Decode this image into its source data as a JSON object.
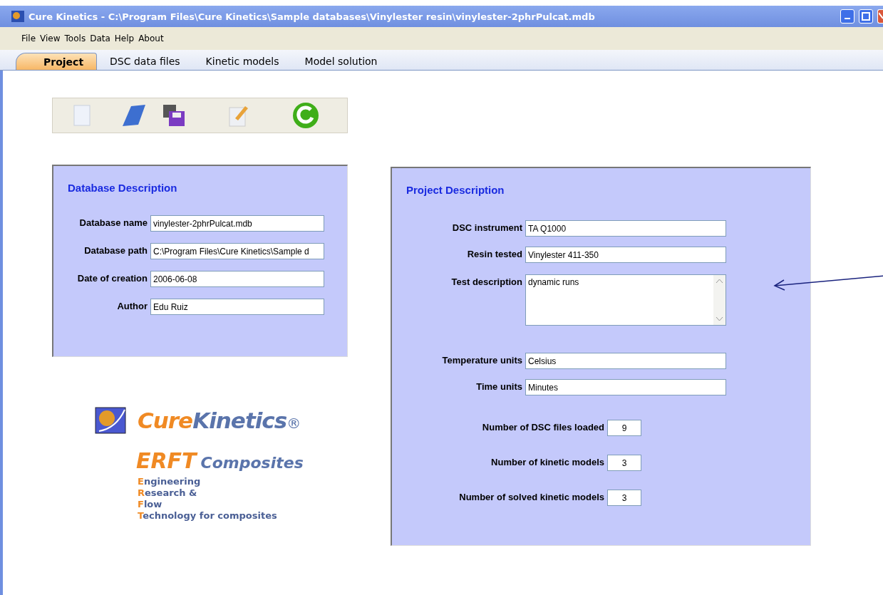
{
  "window": {
    "title": "Cure Kinetics - C:\\Program Files\\Cure Kinetics\\Sample databases\\Vinylester resin\\vinylester-2phrPulcat.mdb"
  },
  "menu": [
    "File",
    "View",
    "Tools",
    "Data",
    "Help",
    "About"
  ],
  "tabs": [
    {
      "label": "Project",
      "selected": true
    },
    {
      "label": "DSC data files",
      "selected": false
    },
    {
      "label": "Kinetic models",
      "selected": false
    },
    {
      "label": "Model solution",
      "selected": false
    }
  ],
  "database": {
    "title": "Database Description",
    "fields": [
      {
        "label": "Database name",
        "value": "vinylester-2phrPulcat.mdb"
      },
      {
        "label": "Database path",
        "value": "C:\\Program Files\\Cure Kinetics\\Sample d"
      },
      {
        "label": "Date of creation",
        "value": "2006-06-08"
      },
      {
        "label": "Author",
        "value": "Edu Ruiz"
      }
    ]
  },
  "logo": {
    "parts": [
      {
        "text": "Cure",
        "color": "#f08a24"
      },
      {
        "text": "Kinetics",
        "color": "#5a74ab"
      }
    ],
    "mark": "®"
  },
  "erft": {
    "parts": [
      {
        "text": "ERFT",
        "color": "#f08a24"
      },
      {
        "text": "Composites",
        "color": "#5a74ab"
      }
    ],
    "tagline": [
      {
        "initial": "E",
        "rest": "ngineering"
      },
      {
        "initial": "R",
        "rest": "esearch &"
      },
      {
        "initial": "F",
        "rest": "low"
      },
      {
        "initial": "T",
        "rest": "echnology for composites"
      }
    ]
  },
  "project": {
    "title": "Project Description",
    "fields": [
      {
        "kind": "text",
        "label": "DSC instrument",
        "value": "TA Q1000"
      },
      {
        "kind": "text",
        "label": "Resin tested",
        "value": "Vinylester 411-350"
      },
      {
        "kind": "memo",
        "label": "Test description",
        "value": "dynamic runs"
      },
      {
        "kind": "text",
        "label": "Temperature units",
        "value": "Celsius"
      },
      {
        "kind": "text",
        "label": "Time units",
        "value": "Minutes"
      }
    ],
    "counts": [
      {
        "label": "Number of DSC files loaded",
        "value": "9"
      },
      {
        "label": "Number of kinetic models",
        "value": "3"
      },
      {
        "label": "Number of solved kinetic models",
        "value": "3"
      }
    ]
  }
}
